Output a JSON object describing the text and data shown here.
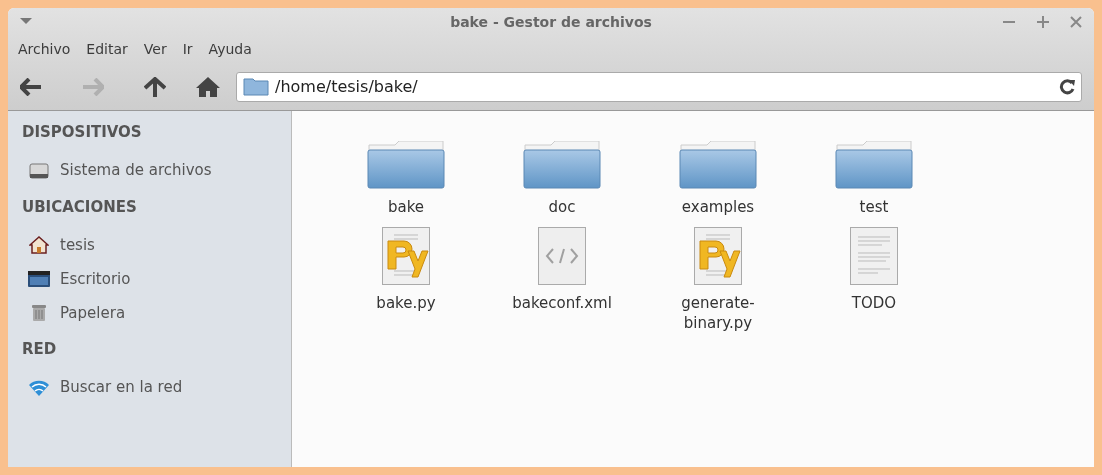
{
  "window": {
    "title": "bake - Gestor de archivos"
  },
  "menu": [
    "Archivo",
    "Editar",
    "Ver",
    "Ir",
    "Ayuda"
  ],
  "location": {
    "path": "/home/tesis/bake/"
  },
  "sidebar": {
    "sections": [
      {
        "title": "DISPOSITIVOS",
        "items": [
          {
            "label": "Sistema de archivos",
            "kind": "drive"
          }
        ]
      },
      {
        "title": "UBICACIONES",
        "items": [
          {
            "label": "tesis",
            "kind": "home"
          },
          {
            "label": "Escritorio",
            "kind": "desktop"
          },
          {
            "label": "Papelera",
            "kind": "trash"
          }
        ]
      },
      {
        "title": "RED",
        "items": [
          {
            "label": "Buscar en la red",
            "kind": "network"
          }
        ]
      }
    ]
  },
  "files": [
    {
      "name": "bake",
      "kind": "folder"
    },
    {
      "name": "doc",
      "kind": "folder"
    },
    {
      "name": "examples",
      "kind": "folder"
    },
    {
      "name": "test",
      "kind": "folder"
    },
    {
      "name": "bake.py",
      "kind": "python"
    },
    {
      "name": "bakeconf.xml",
      "kind": "xml"
    },
    {
      "name": "generate-binary.py",
      "kind": "python"
    },
    {
      "name": "TODO",
      "kind": "text"
    }
  ]
}
